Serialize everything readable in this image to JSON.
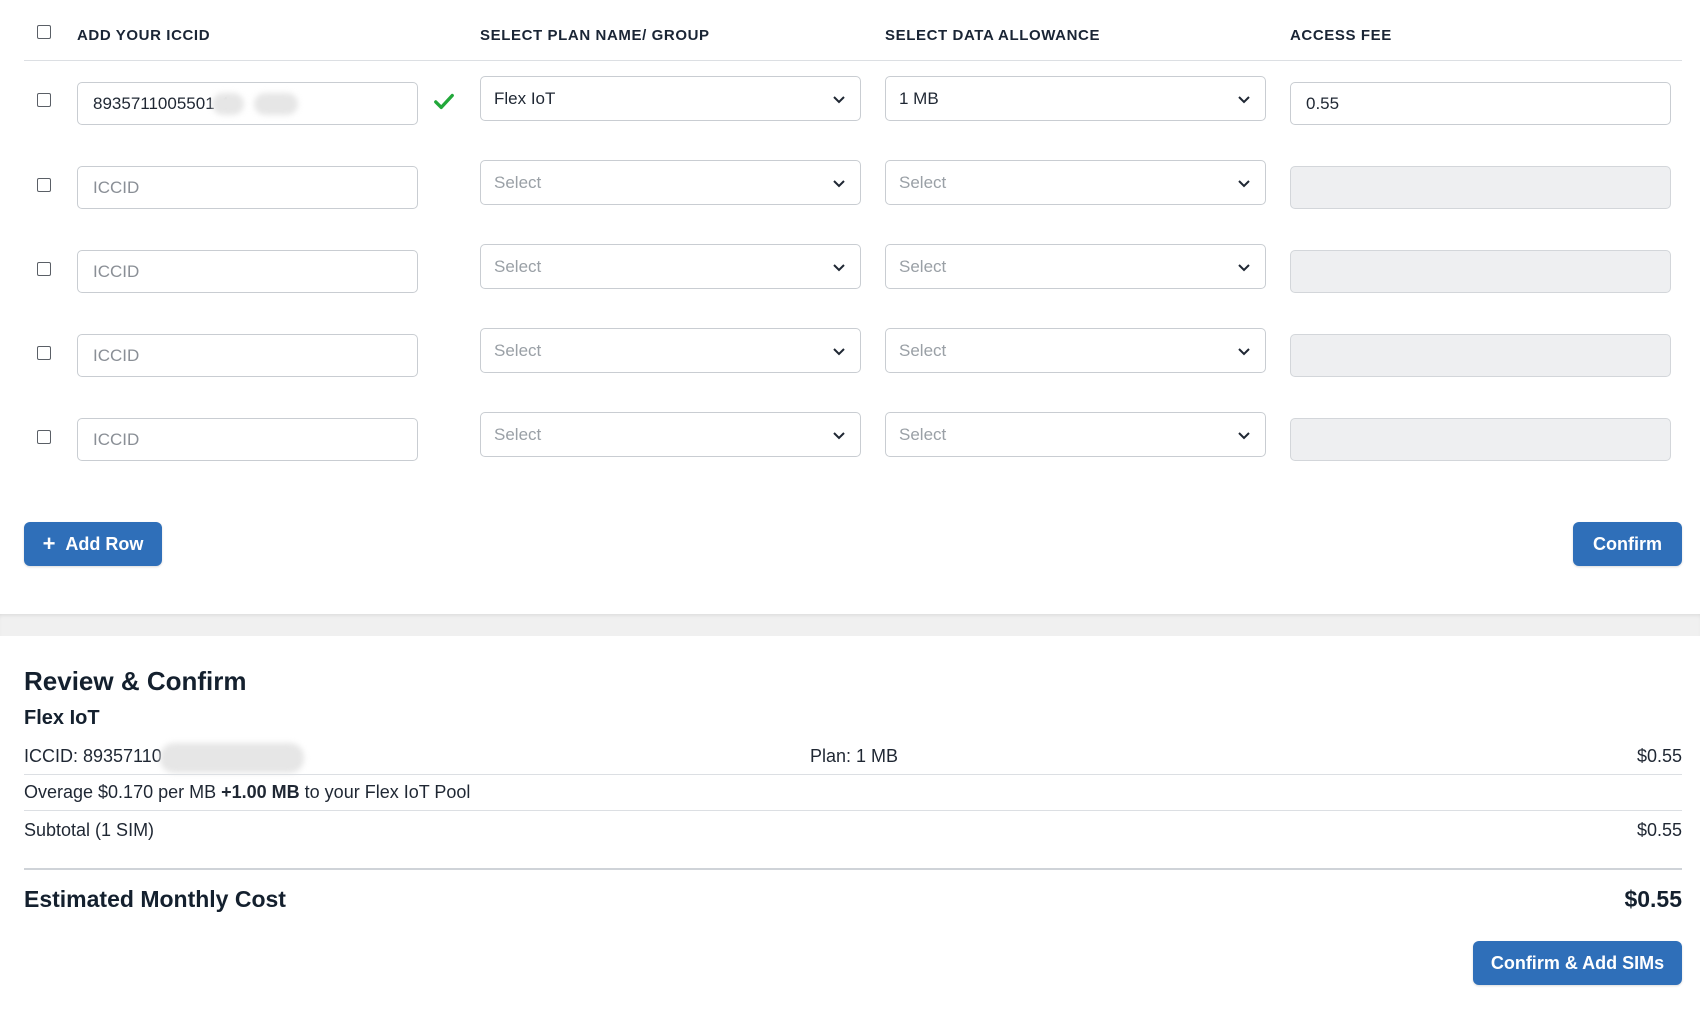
{
  "header": {
    "col_iccid": "ADD YOUR ICCID",
    "col_plan": "SELECT PLAN NAME/ GROUP",
    "col_allowance": "SELECT DATA ALLOWANCE",
    "col_fee": "ACCESS FEE"
  },
  "rows": [
    {
      "iccid": "8935711005501 4",
      "plan": "Flex IoT",
      "allowance": "1 MB",
      "fee": "0.55",
      "valid": true
    },
    {
      "iccid_placeholder": "ICCID",
      "plan": "Select",
      "allowance": "Select",
      "fee": ""
    },
    {
      "iccid_placeholder": "ICCID",
      "plan": "Select",
      "allowance": "Select",
      "fee": ""
    },
    {
      "iccid_placeholder": "ICCID",
      "plan": "Select",
      "allowance": "Select",
      "fee": ""
    },
    {
      "iccid_placeholder": "ICCID",
      "plan": "Select",
      "allowance": "Select",
      "fee": ""
    }
  ],
  "actions": {
    "add_row": "Add Row",
    "confirm": "Confirm"
  },
  "review": {
    "title": "Review & Confirm",
    "group": "Flex IoT",
    "line_iccid": "ICCID: 89357110",
    "line_plan": "Plan: 1 MB",
    "line_price": "$0.55",
    "overage_prefix": "Overage $0.170 per MB ",
    "overage_bold": "+1.00 MB",
    "overage_suffix": " to your Flex IoT Pool",
    "subtotal_label": "Subtotal (1 SIM)",
    "subtotal_value": "$0.55",
    "estimated_label": "Estimated Monthly Cost",
    "estimated_value": "$0.55",
    "confirm_add": "Confirm & Add SIMs"
  },
  "colors": {
    "primary": "#2f6fb9",
    "success_check": "#22a83a",
    "disabled_bg": "#eeeff1"
  }
}
